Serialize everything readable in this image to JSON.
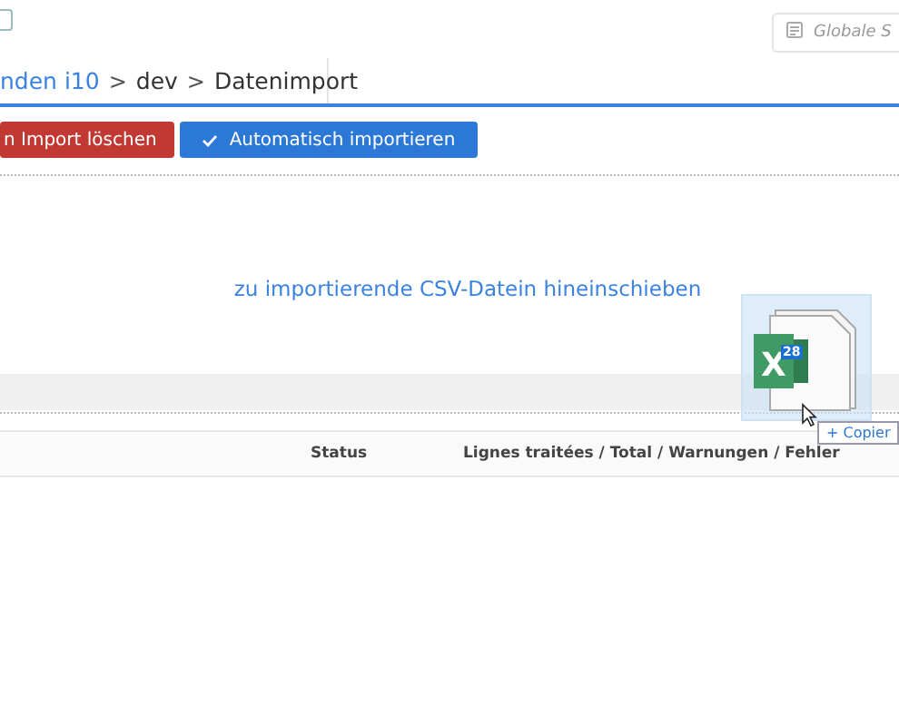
{
  "top_bar": {
    "checkbox": {
      "checked": false
    },
    "search": {
      "placeholder": "Globale S"
    }
  },
  "breadcrumb": [
    {
      "label": "nden i10",
      "kind": "link"
    },
    {
      "label": ">",
      "kind": "separator"
    },
    {
      "label": "dev",
      "kind": "text"
    },
    {
      "label": ">",
      "kind": "separator"
    },
    {
      "label": "Datenimport",
      "kind": "text"
    }
  ],
  "buttons": [
    {
      "label": "n Import löschen",
      "kind": "danger"
    },
    {
      "label": "Automatisch importieren",
      "kind": "primary"
    }
  ],
  "drop_zone": {
    "text": "zu importierende CSV-Datein hineinschieben"
  },
  "table": {
    "columns": [
      "Status",
      "Lignes traitées / Total / Warnungen / Fehler"
    ]
  },
  "drag_overlay": {
    "file_letter": "X",
    "count": "28",
    "action": "+ Copier"
  }
}
